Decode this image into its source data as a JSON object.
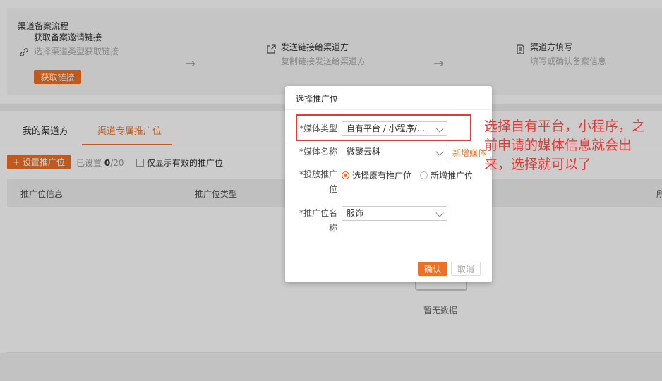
{
  "flow": {
    "title": "渠道备案流程",
    "steps": [
      {
        "title": "获取备案邀请链接",
        "desc": "选择渠道类型获取链接",
        "icon": "link-icon"
      },
      {
        "title": "发送链接给渠道方",
        "desc": "复制链接发送给渠道方",
        "icon": "share-icon"
      },
      {
        "title": "渠道方填写",
        "desc": "填写或确认备案信息",
        "icon": "form-icon"
      }
    ],
    "get_link_label": "获取链接"
  },
  "tabs": [
    {
      "label": "我的渠道方"
    },
    {
      "label": "渠道专属推广位",
      "active": true
    }
  ],
  "toolbar": {
    "set_button": "+ 设置推广位",
    "count_prefix": "已设置 ",
    "count_value": "0",
    "count_total": "/20",
    "only_valid": "仅显示有效的推广位"
  },
  "table": {
    "headers": [
      "推广位信息",
      "推广位类型",
      "所"
    ]
  },
  "empty_text": "暂无数据",
  "modal": {
    "title": "选择推广位",
    "media_type_label": "*媒体类型",
    "media_type_value": "自有平台 / 小程序/...",
    "media_name_label": "*媒体名称",
    "media_name_value": "微聚云科",
    "add_media": "新增媒体",
    "placement_label": "*投放推广位",
    "radio_existing": "选择原有推广位",
    "radio_new": "新增推广位",
    "placement_name_label": "*推广位名称",
    "placement_name_value": "服饰",
    "ok": "确认",
    "cancel": "取消"
  },
  "annotation": "选择自有平台，小程序，之前申请的媒体信息就会出来，选择就可以了",
  "colors": {
    "accent": "#f07023",
    "annotation": "#e53935"
  }
}
